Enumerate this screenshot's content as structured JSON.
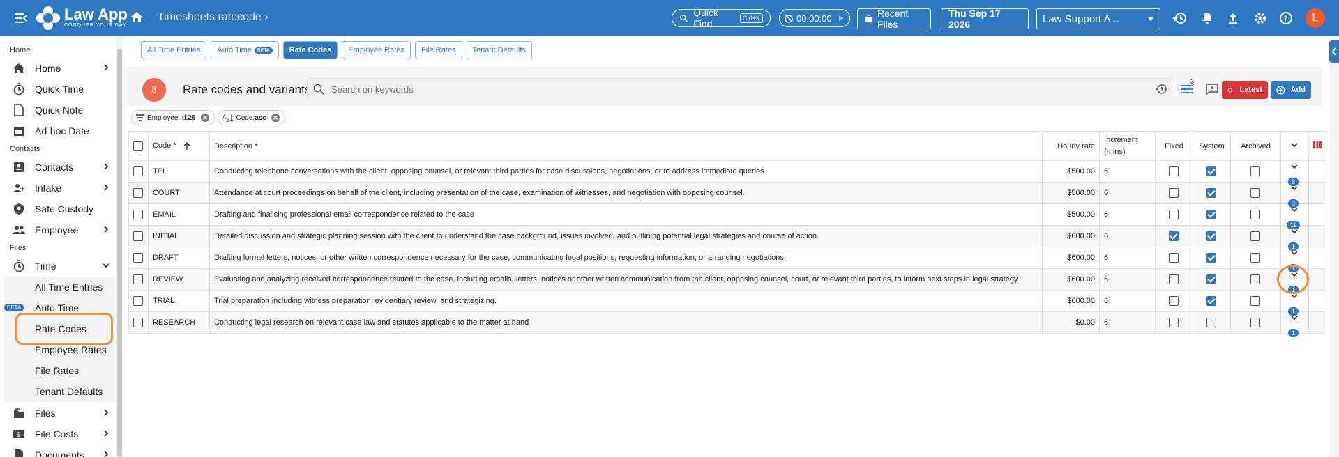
{
  "topbar": {
    "app_name": "Law App",
    "app_tagline": "CONQUER YOUR DAY",
    "breadcrumb": "Timesheets ratecode",
    "quick_find": "Quick Find",
    "quick_find_shortcut": "Ctrl+K",
    "timer": "00:00:00",
    "recent_files": "Recent Files",
    "date": "Thu Sep 17 2026",
    "tenant_select": "Law Support A...",
    "avatar_letter": "L"
  },
  "sidebar": {
    "sections": {
      "home": "Home",
      "contacts": "Contacts",
      "files": "Files"
    },
    "home_items": [
      {
        "label": "Home",
        "icon": "home-icon"
      },
      {
        "label": "Quick Time",
        "icon": "stopwatch-icon"
      },
      {
        "label": "Quick Note",
        "icon": "note-icon"
      },
      {
        "label": "Ad-hoc Date",
        "icon": "calendar-icon"
      }
    ],
    "contacts_items": [
      {
        "label": "Contacts",
        "icon": "contacts-icon"
      },
      {
        "label": "Intake",
        "icon": "intake-icon"
      },
      {
        "label": "Safe Custody",
        "icon": "safe-custody-icon"
      },
      {
        "label": "Employee",
        "icon": "employee-icon"
      }
    ],
    "time_label": "Time",
    "time_sub": [
      "All Time Entries",
      "Auto Time",
      "Rate Codes",
      "Employee Rates",
      "File Rates",
      "Tenant Defaults"
    ],
    "beta_label": "BETA",
    "bottom_items": [
      {
        "label": "Files",
        "icon": "files-icon"
      },
      {
        "label": "File Costs",
        "icon": "file-costs-icon"
      },
      {
        "label": "Documents",
        "icon": "documents-icon"
      }
    ]
  },
  "tabs": [
    {
      "label": "All Time Entries",
      "active": false
    },
    {
      "label": "Auto Time",
      "active": false,
      "beta": "BETA"
    },
    {
      "label": "Rate Codes",
      "active": true
    },
    {
      "label": "Employee Rates",
      "active": false
    },
    {
      "label": "File Rates",
      "active": false
    },
    {
      "label": "Tenant Defaults",
      "active": false
    }
  ],
  "panel": {
    "count": "8",
    "title": "Rate codes and variants",
    "search_placeholder": "Search on keywords",
    "filter_count": "3",
    "latest_label": "Latest",
    "add_label": "Add",
    "chips": [
      {
        "label": "Employee Id:",
        "value": "26"
      },
      {
        "label": "Code:",
        "value": "asc"
      }
    ]
  },
  "table": {
    "headers": {
      "code": "Code *",
      "description": "Description *",
      "hourly_rate": "Hourly rate",
      "increment": "Increment (mins)",
      "fixed": "Fixed",
      "system": "System",
      "archived": "Archived"
    },
    "rows": [
      {
        "code": "TEL",
        "description": "Conducting telephone conversations with the client, opposing counsel, or relevant third parties for case discussions, negotiations, or to address immediate queries",
        "rate": "$500.00",
        "increment": "6",
        "fixed": false,
        "system": true,
        "archived": false,
        "variants": "8"
      },
      {
        "code": "COURT",
        "description": "Attendance at court proceedings on behalf of the client, including presentation of the case, examination of witnesses, and negotiation with opposing counsel.",
        "rate": "$500.00",
        "increment": "6",
        "fixed": false,
        "system": true,
        "archived": false,
        "variants": "3"
      },
      {
        "code": "EMAIL",
        "description": "Drafting and finalising professional email correspondence related to the case",
        "rate": "$500.00",
        "increment": "6",
        "fixed": false,
        "system": true,
        "archived": false,
        "variants": "11"
      },
      {
        "code": "INITIAL",
        "description": "Detailed discussion and strategic planning session with the client to understand the case background, issues involved, and outlining potential legal strategies and course of action",
        "rate": "$600.00",
        "increment": "6",
        "fixed": true,
        "system": true,
        "archived": false,
        "variants": "1"
      },
      {
        "code": "DRAFT",
        "description": "Drafting formal letters, notices, or other written correspondence necessary for the case, communicating legal positions, requesting information, or arranging negotiations.",
        "rate": "$600.00",
        "increment": "6",
        "fixed": false,
        "system": true,
        "archived": false,
        "variants": "1"
      },
      {
        "code": "REVIEW",
        "description": "Evaluating and analyzing received correspondence related to the case, including emails, letters, notices or other written communication from the client, opposing counsel, court, or relevant third parties, to inform next steps in legal strategy",
        "rate": "$600.00",
        "increment": "6",
        "fixed": false,
        "system": true,
        "archived": false,
        "variants": "1"
      },
      {
        "code": "TRIAL",
        "description": "Trial preparation including witness preparation, evidentiary review, and strategizing.",
        "rate": "$600.00",
        "increment": "6",
        "fixed": false,
        "system": true,
        "archived": false,
        "variants": "1"
      },
      {
        "code": "RESEARCH",
        "description": "Conducting legal research on relevant case law and statutes applicable to the matter at hand",
        "rate": "$0.00",
        "increment": "6",
        "fixed": false,
        "system": false,
        "archived": false,
        "variants": "1"
      }
    ]
  },
  "colors": {
    "primary": "#2f78c4",
    "accent": "#f4694e",
    "latest": "#d93636",
    "highlight": "#f0903a"
  }
}
